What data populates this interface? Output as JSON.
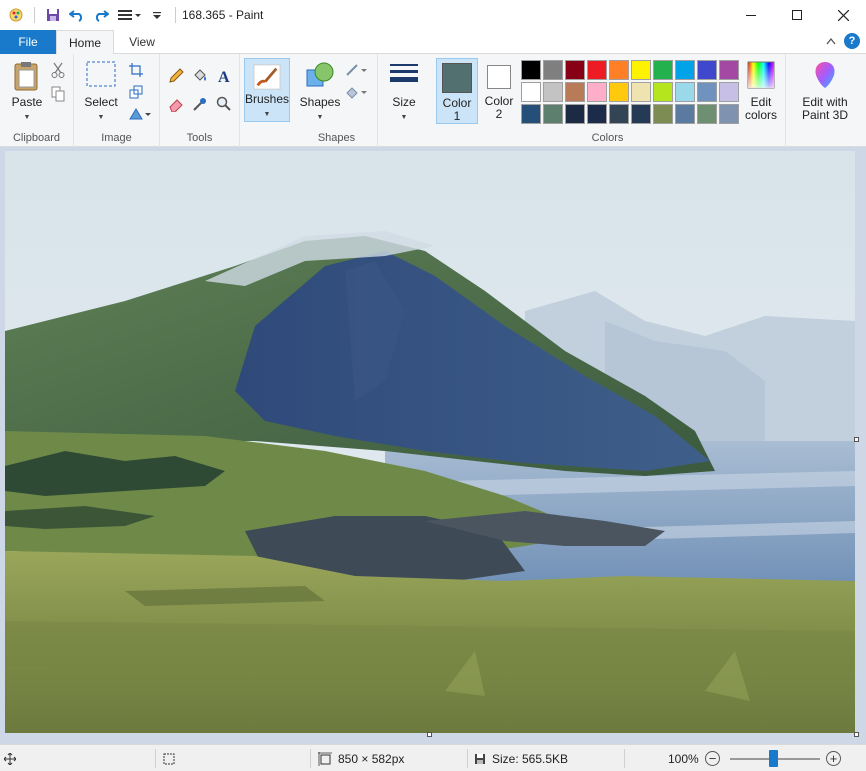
{
  "window": {
    "title": "168.365 - Paint"
  },
  "tabs": {
    "file": "File",
    "home": "Home",
    "view": "View"
  },
  "ribbon": {
    "clipboard": {
      "paste": "Paste",
      "group": "Clipboard"
    },
    "image": {
      "select": "Select",
      "group": "Image"
    },
    "tools": {
      "group": "Tools"
    },
    "brushes": {
      "label": "Brushes"
    },
    "shapes": {
      "label": "Shapes",
      "group": "Shapes"
    },
    "size": {
      "label": "Size"
    },
    "colors": {
      "color1_line1": "Color",
      "color1_line2": "1",
      "color2_line1": "Color",
      "color2_line2": "2",
      "edit_line1": "Edit",
      "edit_line2": "colors",
      "group": "Colors",
      "color1_value": "#52706f",
      "color2_value": "#ffffff",
      "palette": [
        "#000000",
        "#7f7f7f",
        "#880015",
        "#ed1c24",
        "#ff7f27",
        "#fff200",
        "#22b14c",
        "#00a2e8",
        "#3f48cc",
        "#a349a4",
        "#ffffff",
        "#c3c3c3",
        "#b97a57",
        "#ffaec9",
        "#ffc90e",
        "#efe4b0",
        "#b5e61d",
        "#99d9ea",
        "#7092be",
        "#c8bfe7",
        "#254e78",
        "#5c7f6e",
        "#1d2a44",
        "#1c2b4a",
        "#334455",
        "#243a55",
        "#7d8c52",
        "#5a7aa0",
        "#6e8f70",
        "#7f93b0"
      ]
    },
    "paint3d": {
      "line1": "Edit with",
      "line2": "Paint 3D"
    }
  },
  "status": {
    "dimensions": "850 × 582px",
    "size": "Size: 565.5KB",
    "zoom": "100%"
  },
  "icons": {
    "app": "paint-app-icon",
    "save": "save-icon",
    "undo": "undo-icon",
    "redo": "redo-icon"
  }
}
